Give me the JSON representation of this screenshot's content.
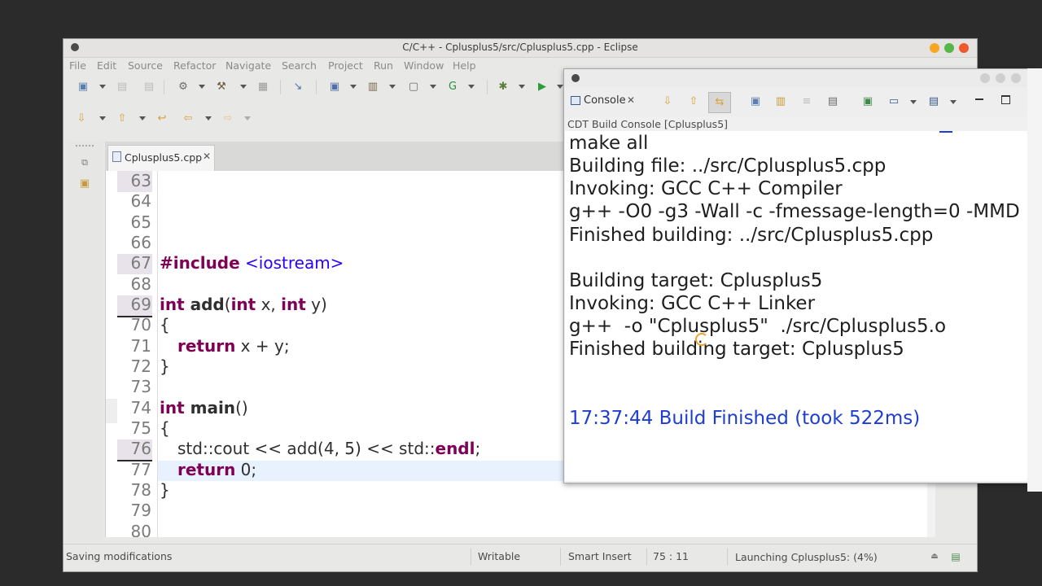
{
  "window": {
    "title": "C/C++ - Cplusplus5/src/Cplusplus5.cpp - Eclipse"
  },
  "menu": [
    "File",
    "Edit",
    "Source",
    "Refactor",
    "Navigate",
    "Search",
    "Project",
    "Run",
    "Window",
    "Help"
  ],
  "editor": {
    "tab_label": "Cplusplus5.cpp",
    "line_numbers": [
      "63",
      "64",
      "65",
      "66",
      "67",
      "68",
      "69",
      "70",
      "71",
      "72",
      "73",
      "74",
      "75",
      "76",
      "77",
      "78",
      "79",
      "80"
    ],
    "code": {
      "l65_kw": "#include",
      "l65_rest": " <iostream>",
      "l67_int1": "int",
      "l67_add": " add",
      "l67_paren": "(",
      "l67_int2": "int",
      "l67_x": " x, ",
      "l67_int3": "int",
      "l67_y": " y)",
      "l68": "{",
      "l69_ret": "return",
      "l69_rest": " x + y;",
      "l70": "}",
      "l72_int": "int",
      "l72_main": " main",
      "l72_rest": "()",
      "l73": "{",
      "l74_a": "std::cout << add(4, 5) << std::",
      "l74_endl": "endl",
      "l74_b": ";",
      "l75_ret": "return",
      "l75_rest": " 0;",
      "l76": "}"
    }
  },
  "status": {
    "message": "Saving modifications",
    "writable": "Writable",
    "insert_mode": "Smart Insert",
    "position": "75 : 11",
    "progress": "Launching Cplusplus5: (4%)"
  },
  "console": {
    "tab_label": "Console",
    "subtitle": "CDT Build Console [Cplusplus5]",
    "lines": [
      "make all",
      "Building file: ../src/Cplusplus5.cpp",
      "Invoking: GCC C++ Compiler",
      "g++ -O0 -g3 -Wall -c -fmessage-length=0 -MMD",
      "Finished building: ../src/Cplusplus5.cpp",
      "",
      "Building target: Cplusplus5",
      "Invoking: GCC C++ Linker",
      "g++  -o \"Cplusplus5\"  ./src/Cplusplus5.o",
      "Finished building target: Cplusplus5"
    ],
    "build_finished": "17:37:44 Build Finished (took 522ms)"
  },
  "colors": {
    "keyword": "#7f0055",
    "console_blue": "#1d3ed0",
    "close": "#ee5a2c",
    "maximize": "#56b648",
    "minimize": "#f5a623"
  }
}
